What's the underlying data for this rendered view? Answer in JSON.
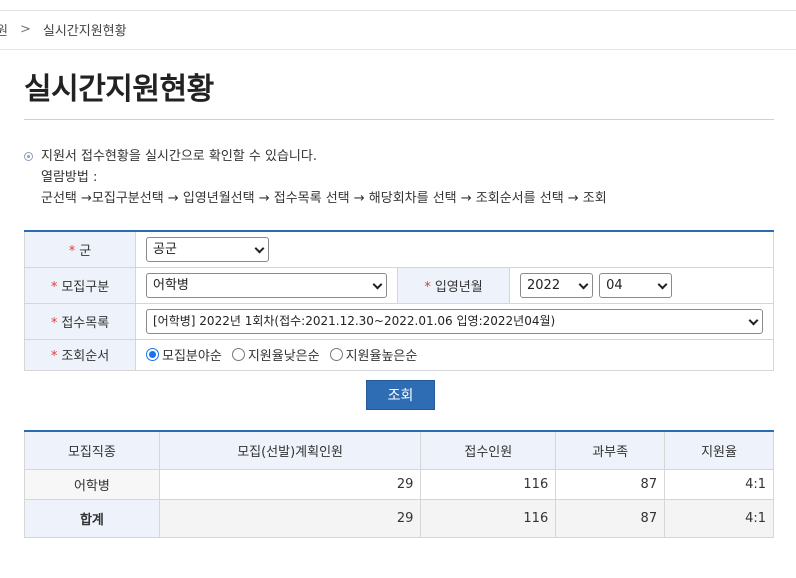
{
  "breadcrumb": {
    "prev": "원",
    "separator": ">",
    "current": "실시간지원현황"
  },
  "page_title": "실시간지원현황",
  "info": {
    "line1": "지원서 접수현황을 실시간으로 확인할 수 있습니다.",
    "line2": "열람방법 :",
    "line3": "군선택 →모집구분선택 → 입영년월선택 → 접수목록 선택 → 해당회차를 선택 → 조회순서를 선택 → 조회"
  },
  "form": {
    "required_mark": "*",
    "army_label": "군",
    "army_value": "공군",
    "recruit_type_label": "모집구분",
    "recruit_type_value": "어학병",
    "enlist_label": "입영년월",
    "enlist_year": "2022",
    "enlist_month": "04",
    "receipt_list_label": "접수목록",
    "receipt_list_value": "[어학병] 2022년 1회차(접수:2021.12.30~2022.01.06 입영:2022년04월)",
    "order_label": "조회순서",
    "order_options": [
      {
        "label": "모집분야순",
        "checked": true
      },
      {
        "label": "지원율낮은순",
        "checked": false
      },
      {
        "label": "지원율높은순",
        "checked": false
      }
    ]
  },
  "search_button": "조회",
  "results": {
    "headers": [
      "모집직종",
      "모집(선발)계획인원",
      "접수인원",
      "과부족",
      "지원율"
    ],
    "rows": [
      [
        "어학병",
        "29",
        "116",
        "87",
        "4:1"
      ]
    ],
    "total": [
      "합계",
      "29",
      "116",
      "87",
      "4:1"
    ]
  },
  "colors": {
    "accent": "#2e6db4",
    "required": "#e53935",
    "header_bg": "#eef3fb"
  }
}
